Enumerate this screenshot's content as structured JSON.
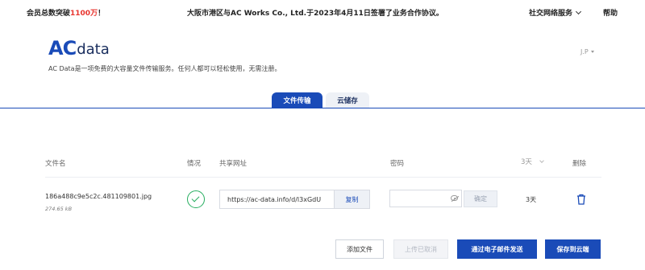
{
  "top_bar": {
    "notice_prefix": "会员总数突破",
    "notice_highlight": "1100万",
    "notice_suffix": "！",
    "announcement": "大阪市港区与AC Works Co., Ltd.于2023年4月11日签署了业务合作协议。",
    "social_menu_label": "社交网络服务",
    "help_label": "帮助"
  },
  "header": {
    "logo_ac": "AC",
    "logo_data": "data",
    "tagline": "AC Data是一项免费的大容量文件传输服务。任何人都可以轻松使用，无需注册。",
    "user_label": "J.P"
  },
  "tabs": [
    {
      "label": "文件传输",
      "active": true
    },
    {
      "label": "云储存",
      "active": false
    }
  ],
  "table": {
    "headers": {
      "filename": "文件名",
      "status": "情况",
      "url": "共享网址",
      "password": "密码",
      "expiry": "3天",
      "delete": "删除"
    },
    "row": {
      "filename": "186a488c9e5c2c.481109801.jpg",
      "filesize": "274.65 kB",
      "url": "https://ac-data.info/d/l3xGdU",
      "copy_label": "复制",
      "password_value": "",
      "password_placeholder": "",
      "confirm_label": "确定",
      "expiry": "3天"
    }
  },
  "actions": {
    "add_file": "添加文件",
    "cancel_upload": "上传已取消",
    "send_email": "通过电子邮件发送",
    "save_cloud": "保存到云端"
  },
  "colors": {
    "brand_blue": "#1a4bb8",
    "highlight_red": "#e8342e",
    "success_green": "#27ae60"
  },
  "icons": {
    "status": "check-circle-icon",
    "password_toggle": "eye-off-icon",
    "delete": "trash-icon"
  }
}
